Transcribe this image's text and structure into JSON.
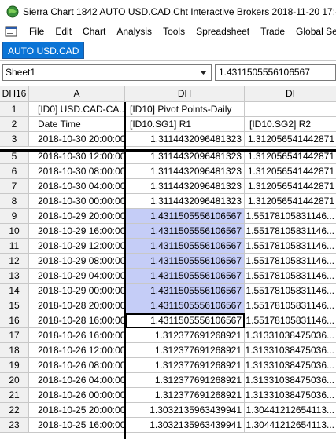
{
  "window": {
    "title": "Sierra Chart 1842 AUTO USD.CAD.Cht  Interactive Brokers 2018-11-20  17:41:1"
  },
  "menu": [
    "File",
    "Edit",
    "Chart",
    "Analysis",
    "Tools",
    "Spreadsheet",
    "Trade",
    "Global Settin"
  ],
  "tab": {
    "label": "AUTO USD.CAD"
  },
  "sheet": {
    "name": "Sheet1",
    "cell_value": "1.4311505556106567"
  },
  "grid": {
    "corner": "DH16",
    "columns": [
      "A",
      "DH",
      "DI"
    ],
    "rows": [
      {
        "n": "1",
        "a": "[ID0] USD.CAD-CA...",
        "dh": "[ID10] Pivot Points-Daily",
        "di": ""
      },
      {
        "n": "2",
        "a": "Date Time",
        "dh": "[ID10.SG1] R1",
        "di": "[ID10.SG2] R2"
      },
      {
        "n": "3",
        "a": "2018-10-30  20:00:00",
        "dh": "1.3114432096481323",
        "di": "1.312056541442871"
      },
      {
        "n": "5",
        "a": "2018-10-30  12:00:00",
        "dh": "1.3114432096481323",
        "di": "1.312056541442871"
      },
      {
        "n": "6",
        "a": "2018-10-30  08:00:00",
        "dh": "1.3114432096481323",
        "di": "1.312056541442871"
      },
      {
        "n": "7",
        "a": "2018-10-30  04:00:00",
        "dh": "1.3114432096481323",
        "di": "1.312056541442871"
      },
      {
        "n": "8",
        "a": "2018-10-30  00:00:00",
        "dh": "1.3114432096481323",
        "di": "1.312056541442871"
      },
      {
        "n": "9",
        "a": "2018-10-29  20:00:00",
        "dh": "1.4311505556106567",
        "di": "1.55178105831146..."
      },
      {
        "n": "10",
        "a": "2018-10-29  16:00:00",
        "dh": "1.4311505556106567",
        "di": "1.55178105831146..."
      },
      {
        "n": "11",
        "a": "2018-10-29  12:00:00",
        "dh": "1.4311505556106567",
        "di": "1.55178105831146..."
      },
      {
        "n": "12",
        "a": "2018-10-29  08:00:00",
        "dh": "1.4311505556106567",
        "di": "1.55178105831146..."
      },
      {
        "n": "13",
        "a": "2018-10-29  04:00:00",
        "dh": "1.4311505556106567",
        "di": "1.55178105831146..."
      },
      {
        "n": "14",
        "a": "2018-10-29  00:00:00",
        "dh": "1.4311505556106567",
        "di": "1.55178105831146..."
      },
      {
        "n": "15",
        "a": "2018-10-28  20:00:00",
        "dh": "1.4311505556106567",
        "di": "1.55178105831146..."
      },
      {
        "n": "16",
        "a": "2018-10-28  16:00:00",
        "dh": "1.4311505556106567",
        "di": "1.55178105831146..."
      },
      {
        "n": "17",
        "a": "2018-10-26  16:00:00",
        "dh": "1.312377691268921",
        "di": "1.31331038475036..."
      },
      {
        "n": "18",
        "a": "2018-10-26  12:00:00",
        "dh": "1.312377691268921",
        "di": "1.31331038475036..."
      },
      {
        "n": "19",
        "a": "2018-10-26  08:00:00",
        "dh": "1.312377691268921",
        "di": "1.31331038475036..."
      },
      {
        "n": "20",
        "a": "2018-10-26  04:00:00",
        "dh": "1.312377691268921",
        "di": "1.31331038475036..."
      },
      {
        "n": "21",
        "a": "2018-10-26  00:00:00",
        "dh": "1.312377691268921",
        "di": "1.31331038475036..."
      },
      {
        "n": "22",
        "a": "2018-10-25  20:00:00",
        "dh": "1.3032135963439941",
        "di": "1.30441212654113..."
      },
      {
        "n": "23",
        "a": "2018-10-25  16:00:00",
        "dh": "1.3032135963439941",
        "di": "1.30441212654113..."
      }
    ]
  },
  "colors": {
    "tab_active": "#0a74d6",
    "selection": "#c5cdf7",
    "header_bg": "#f0f0f0"
  }
}
